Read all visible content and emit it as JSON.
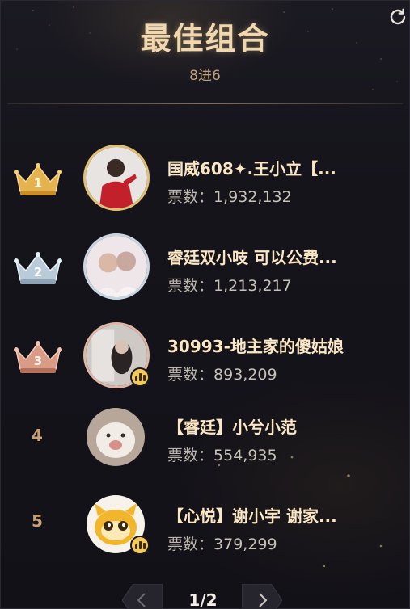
{
  "header": {
    "title": "最佳组合",
    "subtitle": "8进6"
  },
  "colors": {
    "gold": "#e3c071",
    "silver": "#c9d7e3",
    "bronze": "#e0b6a5",
    "accent_text": "#fbe7c3",
    "live_badge": "#f2c95a"
  },
  "entries": [
    {
      "rank": "1",
      "rank_icon": "gold-crown-icon",
      "name": "国威608✦.王小立【...",
      "votes_label": "票数：",
      "votes": "1,932,132",
      "live": false
    },
    {
      "rank": "2",
      "rank_icon": "silver-crown-icon",
      "name": "睿廷双小吱 可以公费...",
      "votes_label": "票数：",
      "votes": "1,213,217",
      "live": false
    },
    {
      "rank": "3",
      "rank_icon": "bronze-crown-icon",
      "name": "30993-地主家的傻姑娘",
      "votes_label": "票数：",
      "votes": "893,209",
      "live": true
    },
    {
      "rank": "4",
      "rank_icon": "",
      "name": "【睿廷】小兮小范",
      "votes_label": "票数：",
      "votes": "554,935",
      "live": false
    },
    {
      "rank": "5",
      "rank_icon": "",
      "name": "【心悦】谢小宇 谢家...",
      "votes_label": "票数：",
      "votes": "379,299",
      "live": true
    }
  ],
  "pagination": {
    "text": "1/2"
  }
}
